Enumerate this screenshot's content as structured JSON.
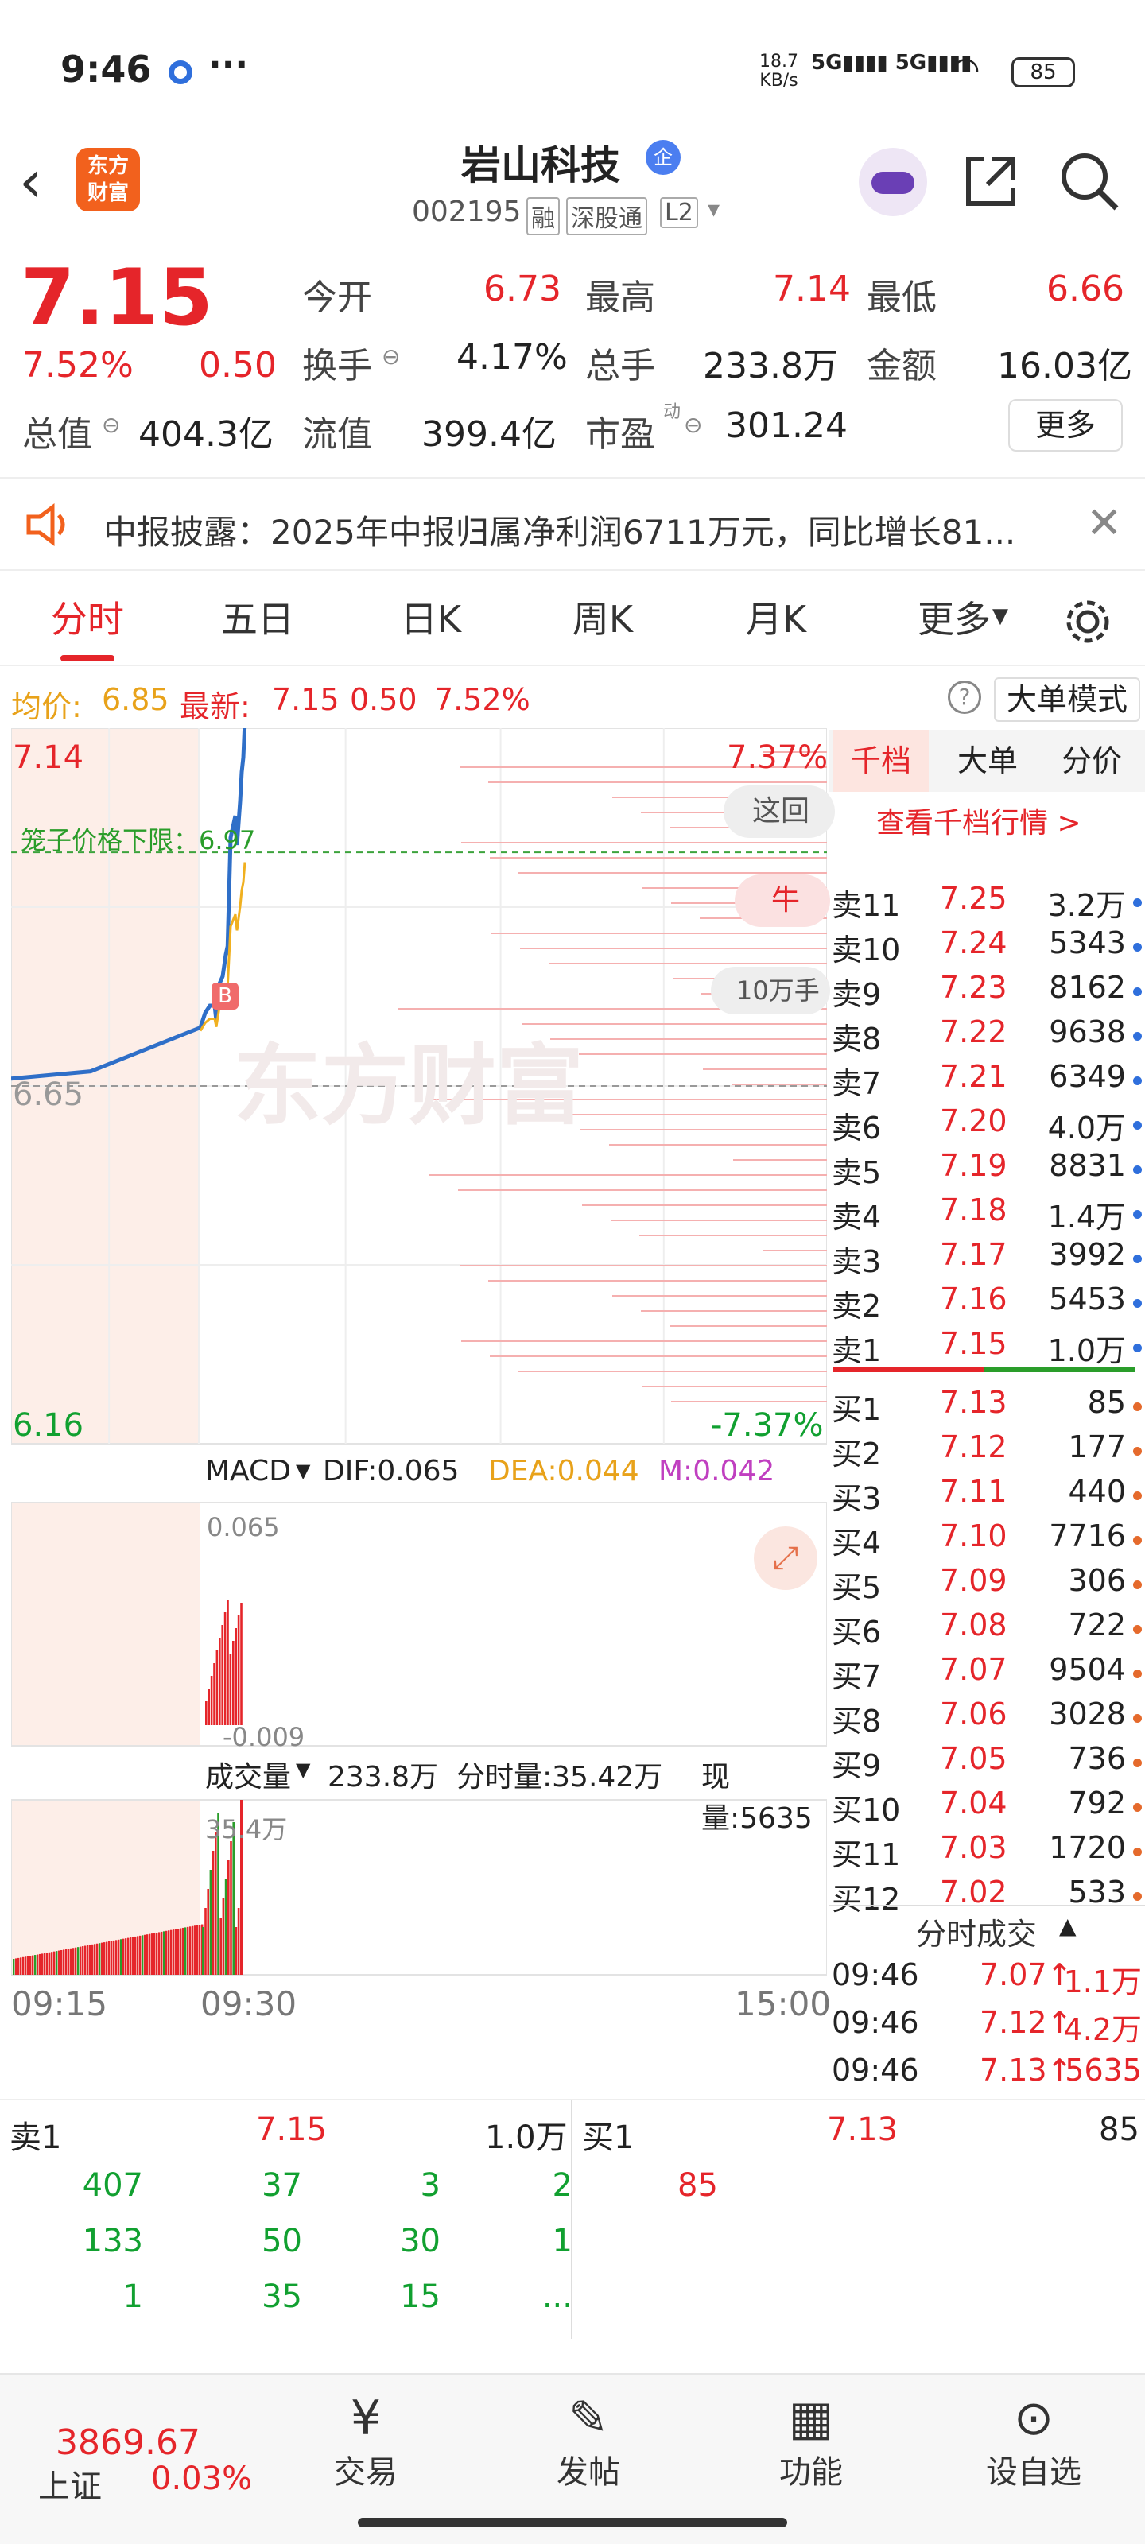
{
  "status": {
    "time": "9:46",
    "net": "18.7\nKB/s",
    "battery": "85"
  },
  "header": {
    "logo_line1": "东方",
    "logo_line2": "财富",
    "stock_name": "岩山科技",
    "code": "002195",
    "tags": [
      "融",
      "深股通",
      "L2"
    ]
  },
  "quote": {
    "price": "7.15",
    "pct": "7.52%",
    "change": "0.50",
    "fields": [
      {
        "label": "今开",
        "value": "6.73"
      },
      {
        "label": "最高",
        "value": "7.14"
      },
      {
        "label": "最低",
        "value": "6.66"
      },
      {
        "label": "换手",
        "value": "4.17%"
      },
      {
        "label": "总手",
        "value": "233.8万"
      },
      {
        "label": "金额",
        "value": "16.03亿"
      },
      {
        "label": "总值",
        "value": "404.3亿"
      },
      {
        "label": "流值",
        "value": "399.4亿"
      },
      {
        "label": "市盈",
        "value": "301.24"
      }
    ],
    "more": "更多",
    "pe_sup": "动"
  },
  "notice": {
    "text": "中报披露：2025年中报归属净利润6711万元，同比增长81..."
  },
  "tabs": [
    "分时",
    "五日",
    "日K",
    "周K",
    "月K",
    "更多"
  ],
  "infobar": {
    "avg_label": "均价:",
    "avg": "6.85",
    "latest_label": "最新:",
    "latest": "7.15",
    "chg": "0.50",
    "pct": "7.52%",
    "mode": "大单模式"
  },
  "chart": {
    "y_top": "7.14",
    "y_mid": "6.65",
    "y_bot": "6.16",
    "pct_top": "7.37%",
    "pct_bot": "-7.37%",
    "cage": "笼子价格下限：6.97",
    "watermark": "东方财富",
    "marker": "B",
    "overlay_1": "这回",
    "overlay_2": "牛",
    "overlay_3": "10万手",
    "macd_label": "MACD",
    "dif": "DIF:0.065",
    "dea": "DEA:0.044",
    "m": "M:0.042",
    "macd_top": "0.065",
    "macd_bot": "-0.009",
    "vol_label": "成交量",
    "vol": "233.8万",
    "fsl": "分时量:35.42万",
    "xl": "现量:5635",
    "vol_top": "35.4万",
    "times": [
      "09:15",
      "09:30",
      "15:00"
    ]
  },
  "chart_data": {
    "type": "line",
    "title": "",
    "xlabel": "",
    "ylabel": "",
    "x": [
      "09:15",
      "09:25",
      "09:30",
      "09:31",
      "09:32",
      "09:33",
      "09:34",
      "09:35",
      "09:36",
      "09:37",
      "09:38",
      "09:39",
      "09:40",
      "09:41",
      "09:42",
      "09:43",
      "09:44",
      "09:45",
      "09:46"
    ],
    "series": [
      {
        "name": "最新",
        "values": [
          6.66,
          6.67,
          6.73,
          6.75,
          6.76,
          6.76,
          6.74,
          6.79,
          6.8,
          6.83,
          6.85,
          6.83,
          6.99,
          7.02,
          6.98,
          7.04,
          7.08,
          7.1,
          7.15
        ]
      }
    ],
    "ylim": [
      6.16,
      7.14
    ],
    "cage_price": 6.97
  },
  "side": {
    "tabs": [
      "千档",
      "大单",
      "分价"
    ],
    "link": "查看千档行情 >",
    "asks": [
      {
        "label": "卖11",
        "price": "7.25",
        "vol": "3.2万"
      },
      {
        "label": "卖10",
        "price": "7.24",
        "vol": "5343"
      },
      {
        "label": "卖9",
        "price": "7.23",
        "vol": "8162"
      },
      {
        "label": "卖8",
        "price": "7.22",
        "vol": "9638"
      },
      {
        "label": "卖7",
        "price": "7.21",
        "vol": "6349"
      },
      {
        "label": "卖6",
        "price": "7.20",
        "vol": "4.0万"
      },
      {
        "label": "卖5",
        "price": "7.19",
        "vol": "8831"
      },
      {
        "label": "卖4",
        "price": "7.18",
        "vol": "1.4万"
      },
      {
        "label": "卖3",
        "price": "7.17",
        "vol": "3992"
      },
      {
        "label": "卖2",
        "price": "7.16",
        "vol": "5453"
      },
      {
        "label": "卖1",
        "price": "7.15",
        "vol": "1.0万"
      }
    ],
    "bids": [
      {
        "label": "买1",
        "price": "7.13",
        "vol": "85"
      },
      {
        "label": "买2",
        "price": "7.12",
        "vol": "177"
      },
      {
        "label": "买3",
        "price": "7.11",
        "vol": "440"
      },
      {
        "label": "买4",
        "price": "7.10",
        "vol": "7716"
      },
      {
        "label": "买5",
        "price": "7.09",
        "vol": "306"
      },
      {
        "label": "买6",
        "price": "7.08",
        "vol": "722"
      },
      {
        "label": "买7",
        "price": "7.07",
        "vol": "9504"
      },
      {
        "label": "买8",
        "price": "7.06",
        "vol": "3028"
      },
      {
        "label": "买9",
        "price": "7.05",
        "vol": "736"
      },
      {
        "label": "买10",
        "price": "7.04",
        "vol": "792"
      },
      {
        "label": "买11",
        "price": "7.03",
        "vol": "1720"
      },
      {
        "label": "买12",
        "price": "7.02",
        "vol": "533"
      }
    ],
    "ticks_title": "分时成交",
    "ticks": [
      {
        "time": "09:46",
        "price": "7.07",
        "vol": "1.1万"
      },
      {
        "time": "09:46",
        "price": "7.12",
        "vol": "4.2万"
      },
      {
        "time": "09:46",
        "price": "7.13",
        "vol": "5635"
      }
    ]
  },
  "queue": {
    "sell_label": "卖1",
    "sell_price": "7.15",
    "sell_vol": "1.0万",
    "buy_label": "买1",
    "buy_price": "7.13",
    "buy_vol": "85",
    "sell_rows": [
      [
        "407",
        "37",
        "3",
        "2"
      ],
      [
        "133",
        "50",
        "30",
        "1"
      ],
      [
        "1",
        "35",
        "15",
        "..."
      ]
    ],
    "buy_rows": [
      [
        "85"
      ]
    ]
  },
  "bottom": {
    "index_value": "3869.67",
    "index_name": "上证",
    "index_pct": "0.03%",
    "items": [
      "交易",
      "发帖",
      "功能",
      "设自选"
    ]
  }
}
